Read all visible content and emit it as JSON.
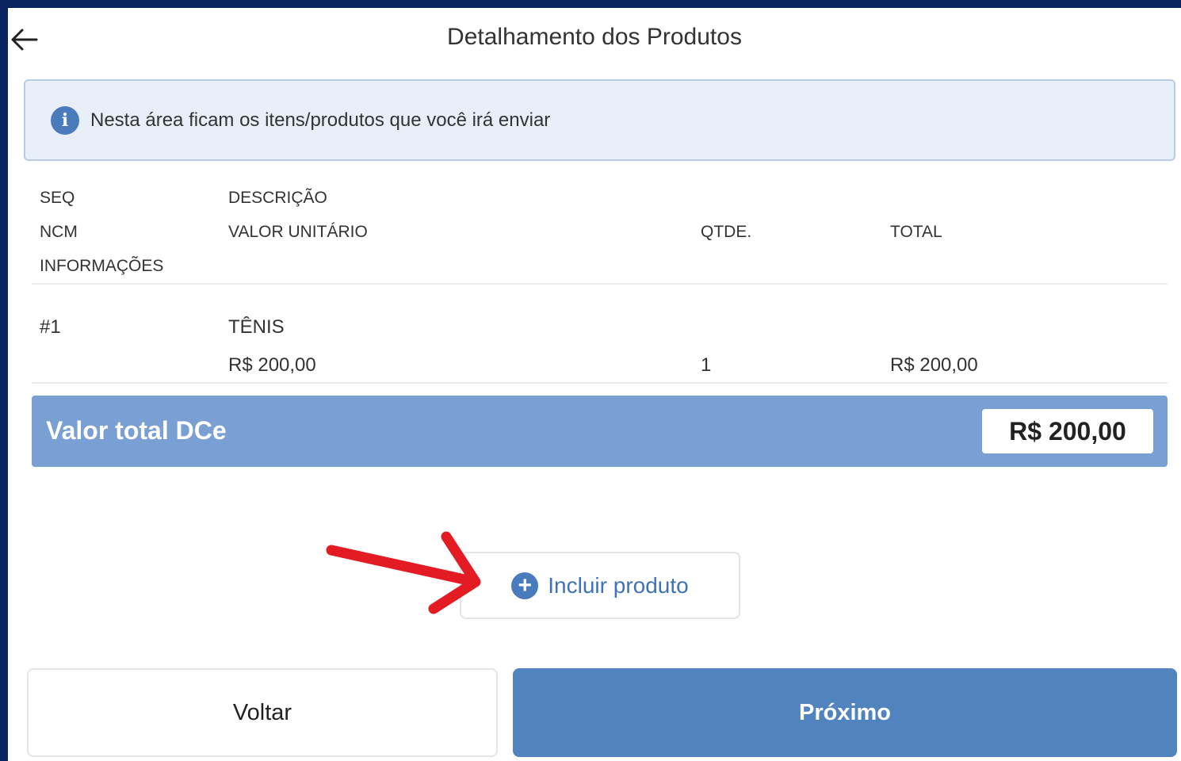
{
  "header": {
    "title": "Detalhamento dos Produtos",
    "back_icon": "arrow-left-icon"
  },
  "info_banner": {
    "icon": "info-icon",
    "icon_glyph": "i",
    "text": "Nesta área ficam os itens/produtos que você irá enviar"
  },
  "table": {
    "headers": {
      "seq": "SEQ",
      "descricao": "DESCRIÇÃO",
      "ncm": "NCM",
      "valor_unitario": "VALOR UNITÁRIO",
      "qtde": "QTDE.",
      "total": "TOTAL",
      "informacoes": "INFORMAÇÕES"
    },
    "rows": [
      {
        "seq": "#1",
        "descricao": "TÊNIS",
        "valor_unitario": "R$ 200,00",
        "qtde": "1",
        "total": "R$ 200,00"
      }
    ]
  },
  "summary": {
    "label": "Valor total DCe",
    "value": "R$ 200,00"
  },
  "add_product": {
    "icon": "plus-circle-icon",
    "icon_glyph": "+",
    "label": "Incluir produto"
  },
  "annotation": {
    "icon": "red-arrow-pointer-icon",
    "color": "#e31b23"
  },
  "footer": {
    "back_label": "Voltar",
    "next_label": "Próximo"
  },
  "colors": {
    "frame": "#0a2460",
    "accent": "#4a7bbd",
    "total_bar": "#7a9fd3",
    "next_button": "#5184be",
    "banner_bg": "#e9eff9"
  }
}
